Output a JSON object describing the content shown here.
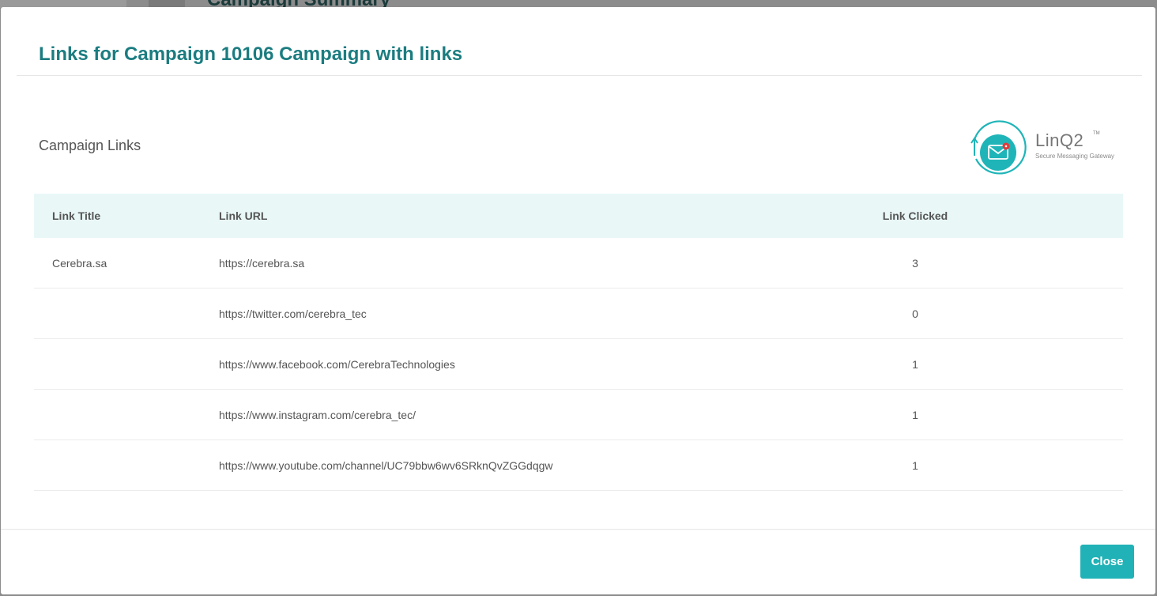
{
  "background": {
    "page_title": "Campaign Summary"
  },
  "modal": {
    "title": "Links for Campaign 10106 Campaign with links",
    "section_title": "Campaign Links",
    "logo": {
      "name": "LinQ2",
      "tm": "TM",
      "tagline": "Secure Messaging Gateway",
      "icon": "envelope-notification-icon",
      "accent_color": "#1fb5b8"
    },
    "table": {
      "headers": [
        "Link Title",
        "Link URL",
        "Link Clicked"
      ],
      "rows": [
        {
          "title": "Cerebra.sa",
          "url": "https://cerebra.sa",
          "clicked": "3"
        },
        {
          "title": "",
          "url": "https://twitter.com/cerebra_tec",
          "clicked": "0"
        },
        {
          "title": "",
          "url": "https://www.facebook.com/CerebraTechnologies",
          "clicked": "1"
        },
        {
          "title": "",
          "url": "https://www.instagram.com/cerebra_tec/",
          "clicked": "1"
        },
        {
          "title": "",
          "url": "https://www.youtube.com/channel/UC79bbw6wv6SRknQvZGGdqgw",
          "clicked": "1"
        }
      ]
    },
    "close_label": "Close"
  },
  "colors": {
    "title": "#1b7c80",
    "header_bg": "#e9f7f7",
    "button": "#20b2b6"
  }
}
